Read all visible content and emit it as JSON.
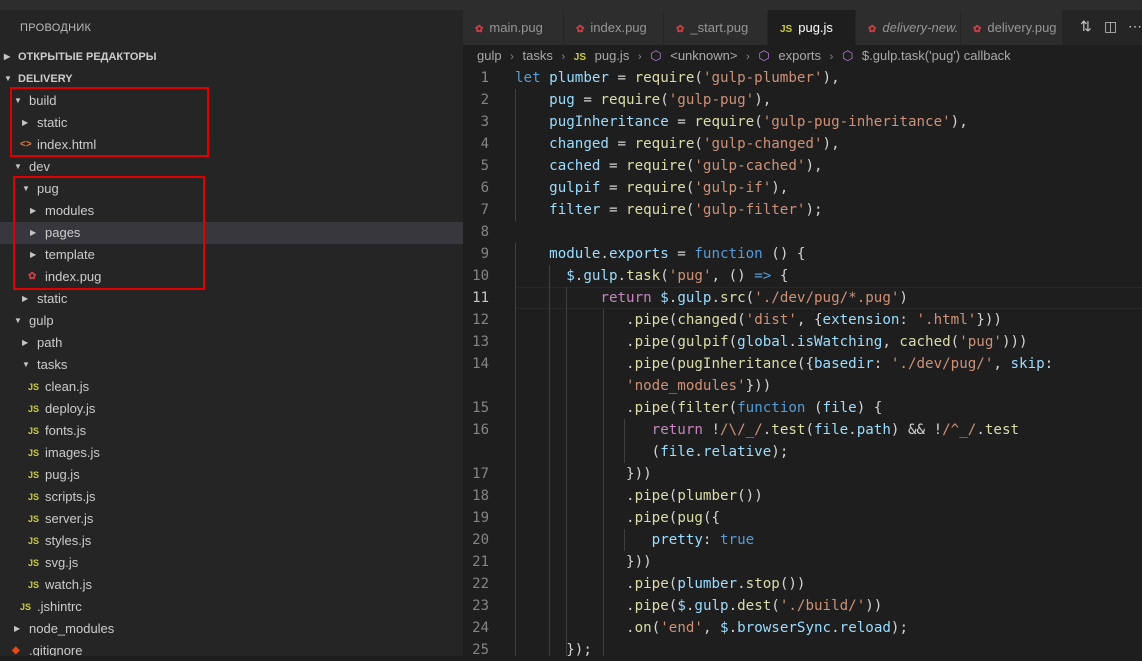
{
  "sidebar": {
    "title": "ПРОВОДНИК",
    "sections": {
      "open_editors": "ОТКРЫТЫЕ РЕДАКТОРЫ",
      "project": "DELIVERY"
    },
    "tree": [
      {
        "label": "build",
        "kind": "folder",
        "open": true,
        "depth": 0
      },
      {
        "label": "static",
        "kind": "folder",
        "open": false,
        "depth": 1
      },
      {
        "label": "index.html",
        "kind": "html",
        "depth": 1
      },
      {
        "label": "dev",
        "kind": "folder",
        "open": true,
        "depth": 0
      },
      {
        "label": "pug",
        "kind": "folder",
        "open": true,
        "depth": 1
      },
      {
        "label": "modules",
        "kind": "folder",
        "open": false,
        "depth": 2
      },
      {
        "label": "pages",
        "kind": "folder",
        "open": false,
        "depth": 2,
        "selected": true
      },
      {
        "label": "template",
        "kind": "folder",
        "open": false,
        "depth": 2
      },
      {
        "label": "index.pug",
        "kind": "pug",
        "depth": 2
      },
      {
        "label": "static",
        "kind": "folder",
        "open": false,
        "depth": 1
      },
      {
        "label": "gulp",
        "kind": "folder",
        "open": true,
        "depth": 0
      },
      {
        "label": "path",
        "kind": "folder",
        "open": false,
        "depth": 1
      },
      {
        "label": "tasks",
        "kind": "folder",
        "open": true,
        "depth": 1
      },
      {
        "label": "clean.js",
        "kind": "js",
        "depth": 2
      },
      {
        "label": "deploy.js",
        "kind": "js",
        "depth": 2
      },
      {
        "label": "fonts.js",
        "kind": "js",
        "depth": 2
      },
      {
        "label": "images.js",
        "kind": "js",
        "depth": 2
      },
      {
        "label": "pug.js",
        "kind": "js",
        "depth": 2
      },
      {
        "label": "scripts.js",
        "kind": "js",
        "depth": 2
      },
      {
        "label": "server.js",
        "kind": "js",
        "depth": 2
      },
      {
        "label": "styles.js",
        "kind": "js",
        "depth": 2
      },
      {
        "label": "svg.js",
        "kind": "js",
        "depth": 2
      },
      {
        "label": "watch.js",
        "kind": "js",
        "depth": 2
      },
      {
        "label": ".jshintrc",
        "kind": "js",
        "depth": 1
      },
      {
        "label": "node_modules",
        "kind": "folder",
        "open": false,
        "depth": 0
      },
      {
        "label": ".gitignore",
        "kind": "git",
        "depth": 0
      }
    ]
  },
  "tabs": [
    {
      "label": "main.pug",
      "icon": "pug",
      "active": false,
      "italic": false
    },
    {
      "label": "index.pug",
      "icon": "pug",
      "active": false,
      "italic": false
    },
    {
      "label": "_start.pug",
      "icon": "pug",
      "active": false,
      "italic": false
    },
    {
      "label": "pug.js",
      "icon": "js",
      "active": true,
      "italic": false
    },
    {
      "label": "delivery-new.",
      "icon": "pug",
      "active": false,
      "italic": true
    },
    {
      "label": "delivery.pug",
      "icon": "pug",
      "active": false,
      "italic": false
    }
  ],
  "breadcrumb": {
    "parts": [
      "gulp",
      "tasks",
      "pug.js",
      "<unknown>",
      "exports",
      "$.gulp.task('pug') callback"
    ]
  },
  "editor": {
    "current_line": 11,
    "line_numbers": [
      "1",
      "2",
      "3",
      "4",
      "5",
      "6",
      "7",
      "8",
      "9",
      "10",
      "11",
      "12",
      "13",
      "14",
      "",
      "15",
      "16",
      "",
      "17",
      "18",
      "19",
      "20",
      "21",
      "22",
      "23",
      "24",
      "25"
    ]
  },
  "colors": {
    "keyword": "#569cd6",
    "string": "#ce9178",
    "variable": "#9cdcfe",
    "function": "#dcdcaa",
    "control": "#c586c0",
    "highlight_box": "#e00000"
  }
}
